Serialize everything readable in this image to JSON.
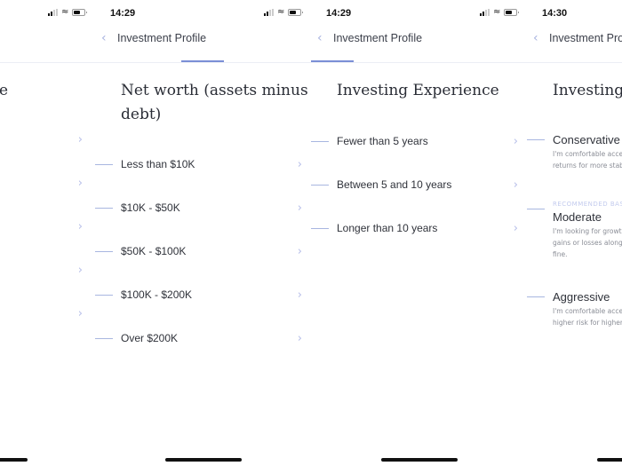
{
  "nav_title": "Investment Profile",
  "panels": [
    {
      "time": "",
      "heading_partial": "ne",
      "option_count": 5
    },
    {
      "time": "14:29",
      "heading": "Net worth (assets minus debt)",
      "options": [
        "Less than $10K",
        "$10K - $50K",
        "$50K - $100K",
        "$100K - $200K",
        "Over $200K"
      ]
    },
    {
      "time": "14:29",
      "heading": "Investing Experience",
      "options": [
        "Fewer than 5 years",
        "Between 5 and 10 years",
        "Longer than 10 years"
      ]
    },
    {
      "time": "14:30",
      "heading": "Investing",
      "risk_options": [
        {
          "name": "Conservative",
          "tag": "",
          "desc": [
            "I'm comfortable accep",
            "returns for more stabil"
          ]
        },
        {
          "name": "Moderate",
          "tag": "RECOMMENDED BAS",
          "desc": [
            "I'm looking for growth",
            "gains or losses along th",
            "fine."
          ]
        },
        {
          "name": "Aggressive",
          "tag": "",
          "desc": [
            "I'm comfortable accep",
            "higher risk for higher r"
          ]
        }
      ]
    }
  ],
  "icons": {
    "back": "‹",
    "chevron": "›",
    "wifi": "wifi-icon"
  },
  "colors": {
    "accent": "#7a8fd6",
    "dash": "#a8b6e0",
    "chevron": "#b5bde8"
  }
}
